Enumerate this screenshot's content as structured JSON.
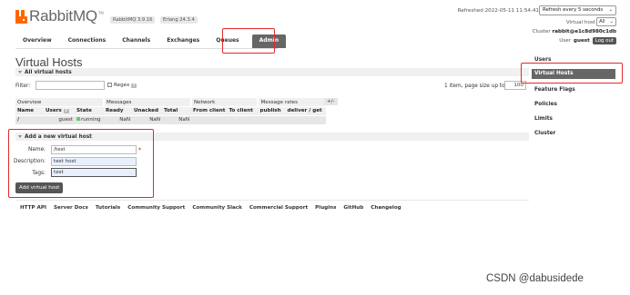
{
  "header": {
    "logo_text": "RabbitMQ",
    "logo_tm": "TM",
    "version": "RabbitMQ 3.9.16",
    "erlang": "Erlang 24.3.4",
    "refreshed": "Refreshed 2022-05-11 11:54:41",
    "refresh_option": "Refresh every 5 seconds",
    "virtual_host_label": "Virtual host",
    "virtual_host_value": "All",
    "cluster_label": "Cluster",
    "cluster_value": "rabbit@e1c8d980c1db",
    "user_label": "User",
    "user_value": "guest",
    "logout": "Log out"
  },
  "tabs": [
    {
      "label": "Overview"
    },
    {
      "label": "Connections"
    },
    {
      "label": "Channels"
    },
    {
      "label": "Exchanges"
    },
    {
      "label": "Queues"
    },
    {
      "label": "Admin"
    }
  ],
  "page_title": "Virtual Hosts",
  "all_section": "All virtual hosts",
  "filter": {
    "label": "Filter:",
    "value": "",
    "regex_label": "Regex",
    "help": "?",
    "page_size_label": "1 item, page size up to",
    "page_size_value": "100"
  },
  "table": {
    "groups": [
      "Overview",
      "Messages",
      "Network",
      "Message rates"
    ],
    "plusminus": "+/-",
    "headers": [
      "Name",
      "Users",
      "State",
      "Ready",
      "Unacked",
      "Total",
      "From client",
      "To client",
      "publish",
      "deliver / get"
    ],
    "rows": [
      {
        "name": "/",
        "users": "guest",
        "state": "running",
        "ready": "NaN",
        "unacked": "NaN",
        "total": "NaN",
        "from_client": "",
        "to_client": "",
        "publish": "",
        "deliver": ""
      }
    ]
  },
  "add_section": "Add a new virtual host",
  "form": {
    "name_label": "Name:",
    "name_value": "/test",
    "description_label": "Description:",
    "description_value": "test host",
    "tags_label": "Tags:",
    "tags_value": "test",
    "required": "*",
    "submit": "Add virtual host"
  },
  "right_nav": [
    {
      "label": "Users"
    },
    {
      "label": "Virtual Hosts"
    },
    {
      "label": "Feature Flags"
    },
    {
      "label": "Policies"
    },
    {
      "label": "Limits"
    },
    {
      "label": "Cluster"
    }
  ],
  "footer": [
    "HTTP API",
    "Server Docs",
    "Tutorials",
    "Community Support",
    "Community Slack",
    "Commercial Support",
    "Plugins",
    "GitHub",
    "Changelog"
  ],
  "watermark": "CSDN @dabusidede",
  "colors": {
    "brand": "#ff6600",
    "highlight": "#e02a2a",
    "active_tab": "#666666"
  }
}
